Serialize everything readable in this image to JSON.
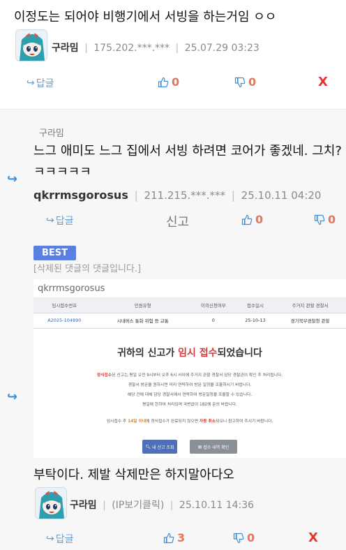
{
  "comment1": {
    "body": "이정도는 되어야 비행기에서 서빙을 하는거임 ㅇㅇ",
    "nickname": "구라밈",
    "ip": "175.202.***.***",
    "datetime": "25.07.29 03:23",
    "reply_label": "답글",
    "upvotes": "0",
    "downvotes": "0",
    "delete_label": "X"
  },
  "reply1": {
    "reply_to": "구라밈",
    "body_line1": "느그 애미도 느그 집에서 서빙 하려면 코어가 좋겠네. 그치?",
    "body_line2": "ㅋㅋㅋㅋㅋ",
    "nickname": "qkrrmsgorosus",
    "ip": "211.215.***.***",
    "datetime": "25.10.11 04:20",
    "reply_label": "답글",
    "report_label": "신고",
    "upvotes": "0",
    "downvotes": "0"
  },
  "reply2": {
    "badge": "BEST",
    "deleted_note": "[삭제된 댓글의 댓글입니다.]",
    "reply_to": "qkrrmsgorosus",
    "image": {
      "headers": [
        "임시접수번호",
        "민원유형",
        "이의신청여부",
        "접수일시",
        "주거지 관할 경찰서"
      ],
      "row": [
        "A2025-104890",
        "시내버스 통화 위험 등 교통",
        "0",
        "25-10-13",
        "경기북부경찰청 관할"
      ],
      "headline_pre": "귀하의 신고가 ",
      "headline_hl": "임시 접수",
      "headline_post": "되었습니다",
      "line1_r": "정식접수",
      "line1": "된 신고는 평일 오전 9시부터 오후 6시 사이에 주거지 관할 경찰서 담당 경찰관이 확인 후 처리됩니다.",
      "line2": "경찰서 방문을 원하시면 미리 연락하여 방문 일정을 조율하시기 바랍니다.",
      "line3": "해당 건에 대해 담당 경찰서에서 연락하여 방문일정을 조율할 수 있습니다.",
      "line4": "평일에 한하여 처리되며 국번없이 182에 문의 바랍니다.",
      "line5_a": "임시접수 후 ",
      "line5_o": "14일 이내",
      "line5_b": "에 정식접수가 완료되지 않으면 ",
      "line5_r": "자동 취소",
      "line5_c": "되오니 참고하여 주시기 바랍니다.",
      "btn1": "내 신고 조회",
      "btn2": "접수 내역 확인"
    },
    "body": "부탁이다. 제발 삭제만은 하지말아다오",
    "nickname": "구라밈",
    "ip": "(IP보기클릭)",
    "datetime": "25.10.11 14:36",
    "reply_label": "답글",
    "upvotes": "3",
    "downvotes": "0",
    "delete_label": "X"
  }
}
